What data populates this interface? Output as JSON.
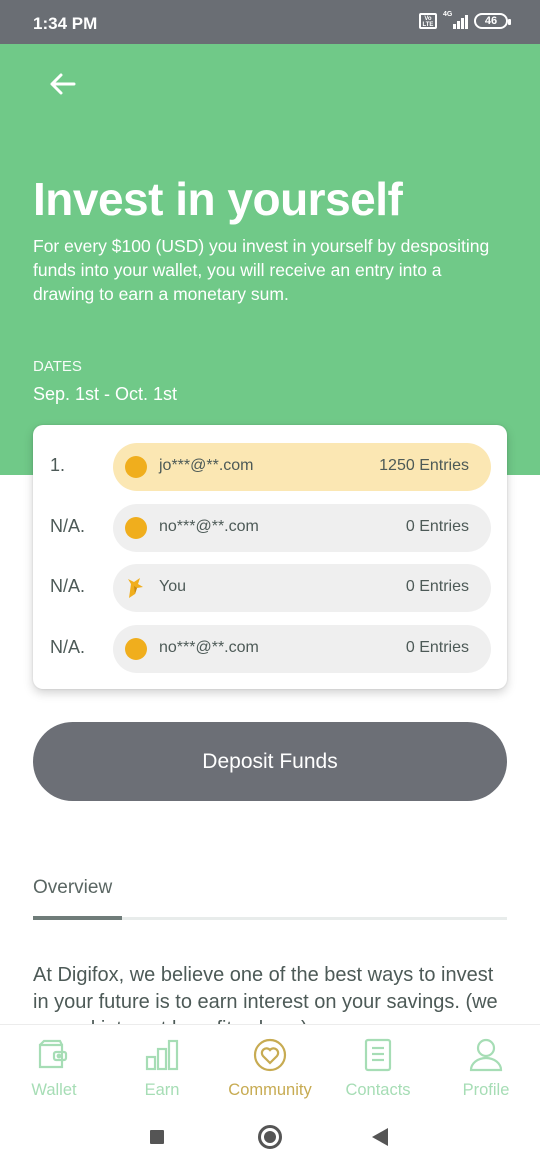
{
  "status_bar": {
    "time": "1:34 PM",
    "volte": "Vo LTE",
    "network": "4G",
    "battery": "46"
  },
  "header": {
    "back_icon": "arrow-left-icon",
    "title": "Invest in yourself",
    "description": "For every $100 (USD) you invest in yourself by despositing funds into your wallet, you will receive an entry into a drawing to earn a monetary sum.",
    "dates_label": "DATES",
    "dates_value": "Sep. 1st - Oct. 1st"
  },
  "leaderboard": [
    {
      "rank": "1.",
      "name": "jo***@**.com",
      "entries": "1250 Entries",
      "highlight": true,
      "avatar": "coin-icon"
    },
    {
      "rank": "N/A.",
      "name": "no***@**.com",
      "entries": "0 Entries",
      "highlight": false,
      "avatar": "coin-icon"
    },
    {
      "rank": "N/A.",
      "name": "You",
      "entries": "0 Entries",
      "highlight": false,
      "avatar": "fox-icon"
    },
    {
      "rank": "N/A.",
      "name": "no***@**.com",
      "entries": "0 Entries",
      "highlight": false,
      "avatar": "coin-icon"
    }
  ],
  "deposit_button": "Deposit Funds",
  "overview": {
    "tab_label": "Overview",
    "text": "At Digifox, we believe one of the best ways to invest in your future is to earn interest on your savings. (we earned interest benefits also...)"
  },
  "bottom_nav": [
    {
      "label": "Wallet",
      "icon": "wallet-icon",
      "active": false
    },
    {
      "label": "Earn",
      "icon": "bar-chart-icon",
      "active": false
    },
    {
      "label": "Community",
      "icon": "heart-circle-icon",
      "active": true
    },
    {
      "label": "Contacts",
      "icon": "contacts-book-icon",
      "active": false
    },
    {
      "label": "Profile",
      "icon": "person-icon",
      "active": false
    }
  ],
  "colors": {
    "header_green": "#70c988",
    "highlight_pill": "#fbe7b3",
    "coin": "#f0ae1d",
    "button_gray": "#6c6f76",
    "nav_inactive": "#a6ddb5",
    "nav_active": "#c7ab52"
  }
}
